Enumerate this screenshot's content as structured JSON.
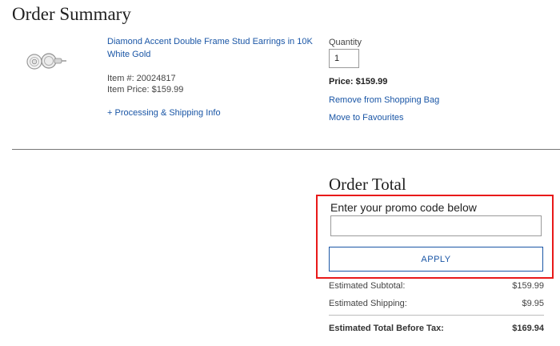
{
  "page": {
    "title": "Order Summary"
  },
  "product": {
    "name": "Diamond Accent Double Frame Stud Earrings in 10K White Gold",
    "item_number": "Item #: 20024817",
    "item_price": "Item Price: $159.99",
    "processing_link": "+ Processing & Shipping Info",
    "image_icon": "stud-earrings-image"
  },
  "quantity": {
    "label": "Quantity",
    "value": "1",
    "price": "Price: $159.99",
    "remove_link": "Remove from Shopping Bag",
    "favourites_link": "Move to Favourites"
  },
  "order_total": {
    "title": "Order Total",
    "promo_label": "Enter your promo code below",
    "promo_value": "",
    "apply_label": "APPLY",
    "subtotal_label": "Estimated Subtotal:",
    "subtotal_value": "$159.99",
    "shipping_label": "Estimated Shipping:",
    "shipping_value": "$9.95",
    "total_label": "Estimated Total Before Tax:",
    "total_value": "$169.94"
  },
  "colors": {
    "link": "#1a56a6",
    "highlight": "#e81919"
  }
}
